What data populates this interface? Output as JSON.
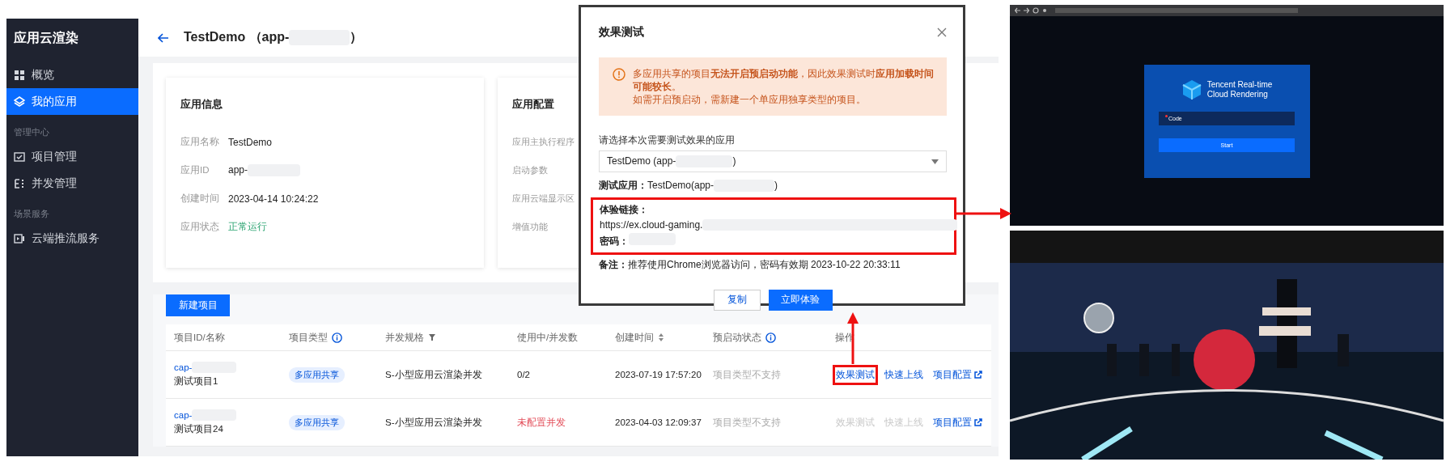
{
  "sidebar": {
    "title": "应用云渲染",
    "sections": [
      {
        "items": [
          {
            "label": "概览",
            "selected": false
          },
          {
            "label": "我的应用",
            "selected": true
          }
        ]
      },
      {
        "heading": "管理中心",
        "items": [
          {
            "label": "项目管理",
            "selected": false
          },
          {
            "label": "并发管理",
            "selected": false
          }
        ]
      },
      {
        "heading": "场景服务",
        "items": [
          {
            "label": "云端推流服务",
            "selected": false
          }
        ]
      }
    ]
  },
  "header": {
    "title": {
      "text": "TestDemo （app-",
      "redacted": true,
      "after": "）"
    }
  },
  "info_card": {
    "title": "应用信息",
    "fields": [
      {
        "label": "应用名称",
        "kind": "text",
        "value": {
          "text": "TestDemo"
        }
      },
      {
        "label": "应用ID",
        "kind": "text",
        "value": {
          "text": "app-",
          "redacted": true
        }
      },
      {
        "label": "创建时间",
        "kind": "text",
        "value": {
          "text": "2023-04-14 10:24:22"
        }
      },
      {
        "label": "应用状态",
        "kind": "status",
        "value": {
          "text": "正常运行"
        }
      }
    ]
  },
  "config_card": {
    "title": "应用配置",
    "fields": [
      "应用主执行程序",
      "启动参数",
      "应用云端显示区",
      "增值功能"
    ]
  },
  "new_project_button": "新建项目",
  "table": {
    "columns": [
      "项目ID/名称",
      "项目类型",
      "并发规格",
      "使用中/并发数",
      "创建时间",
      "预启动状态",
      "操作"
    ],
    "rows": [
      {
        "id": {
          "text": "cap-",
          "redacted": true
        },
        "name": "测试项目1",
        "type": "多应用共享",
        "spec": "S-小型应用云渲染并发",
        "usage": {
          "text": "0/2",
          "alert": false
        },
        "created": "2023-07-19 17:57:20",
        "prestart": "项目类型不支持",
        "actions": [
          {
            "label": "效果测试",
            "disabled": false,
            "external": false,
            "highlighted": true
          },
          {
            "label": "快速上线",
            "disabled": false,
            "external": false,
            "highlighted": false
          },
          {
            "label": "项目配置",
            "disabled": false,
            "external": true,
            "highlighted": false
          }
        ]
      },
      {
        "id": {
          "text": "cap-",
          "redacted": true
        },
        "name": "测试项目24",
        "type": "多应用共享",
        "spec": "S-小型应用云渲染并发",
        "usage": {
          "text": "未配置并发",
          "alert": true
        },
        "created": "2023-04-03 12:09:37",
        "prestart": "项目类型不支持",
        "actions": [
          {
            "label": "效果测试",
            "disabled": true,
            "external": false,
            "highlighted": false
          },
          {
            "label": "快速上线",
            "disabled": true,
            "external": false,
            "highlighted": false
          },
          {
            "label": "项目配置",
            "disabled": false,
            "external": true,
            "highlighted": false
          }
        ]
      }
    ]
  },
  "modal": {
    "title": "效果测试",
    "notice": [
      "多应用共享的项目**无法开启预启动功能**，因此效果测试时**应用加载时间可能较长**。",
      "如需开启预启动，需新建一个单应用独享类型的项目。"
    ],
    "select_label": "请选择本次需要测试效果的应用",
    "select": {
      "text": "TestDemo (app-",
      "redacted": true,
      "after": ")"
    },
    "test_app": {
      "label": "测试应用：",
      "value": {
        "text": "TestDemo(app-",
        "redacted": true,
        "after": ")"
      }
    },
    "link_section": {
      "highlighted": true,
      "link_label": "体验链接：",
      "link": {
        "text": "https://ex.cloud-gaming.",
        "redacted": true
      },
      "password_label": "密码：",
      "password": {
        "redacted": true
      }
    },
    "note": "**备注：**推荐使用Chrome浏览器访问，密码有效期 2023-10-22 20:33:11",
    "buttons": [
      {
        "label": "复制",
        "primary": false
      },
      {
        "label": "立即体验",
        "primary": true
      }
    ]
  },
  "preview": {
    "login": {
      "title_lines": [
        "Tencent Real-time",
        "Cloud Rendering"
      ],
      "field_label": "Code",
      "required": true,
      "button": "Start"
    }
  }
}
